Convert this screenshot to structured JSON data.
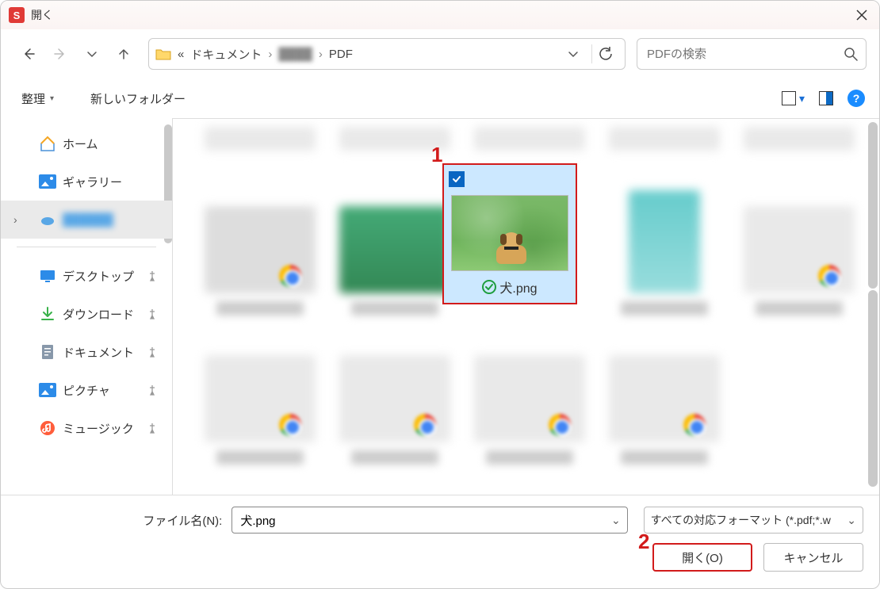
{
  "annotations": {
    "one": "1",
    "two": "2"
  },
  "titlebar": {
    "app_badge": "S",
    "title": "開く"
  },
  "nav": {
    "breadcrumb": {
      "prefix": "«",
      "seg1": "ドキュメント",
      "sep": "›",
      "seg2_hidden": "████",
      "seg3": "PDF"
    },
    "search_placeholder": "PDFの検索"
  },
  "toolbar": {
    "organize": "整理",
    "new_folder": "新しいフォルダー",
    "help": "?"
  },
  "sidebar": {
    "home": "ホーム",
    "gallery": "ギャラリー",
    "hidden_item": "██████",
    "desktop": "デスクトップ",
    "downloads": "ダウンロード",
    "documents": "ドキュメント",
    "pictures": "ピクチャ",
    "music": "ミュージック"
  },
  "selected_file": {
    "name": "犬.png"
  },
  "footer": {
    "filename_label": "ファイル名(N):",
    "filename_value": "犬.png",
    "filetype_value": "すべての対応フォーマット (*.pdf;*.w",
    "open": "開く(O)",
    "cancel": "キャンセル"
  },
  "colors": {
    "annotation": "#d21b1b",
    "select_bg": "#cce8ff",
    "accent": "#0a66c2"
  }
}
